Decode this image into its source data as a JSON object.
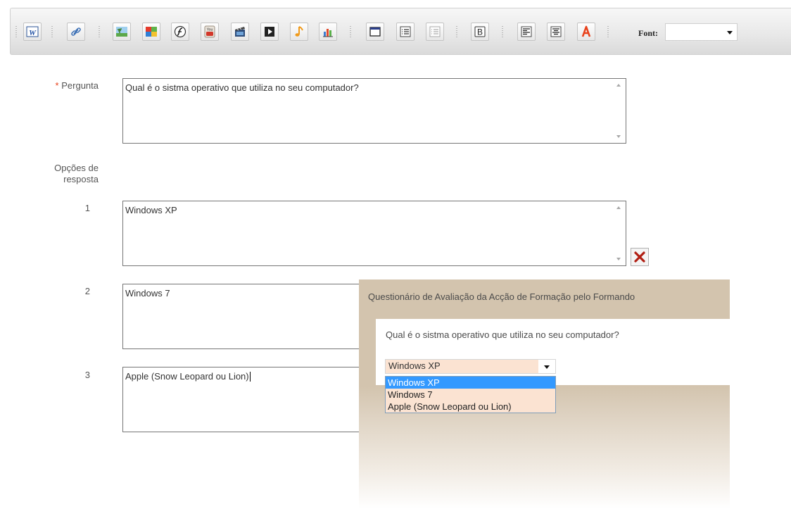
{
  "toolbar": {
    "buttons": [
      {
        "name": "word-icon"
      },
      {
        "name": "link-icon"
      },
      {
        "name": "image-icon"
      },
      {
        "name": "gallery-icon"
      },
      {
        "name": "flash-icon"
      },
      {
        "name": "youtube-icon"
      },
      {
        "name": "video-icon"
      },
      {
        "name": "play-icon"
      },
      {
        "name": "audio-icon"
      },
      {
        "name": "chart-icon"
      },
      {
        "name": "window-icon"
      },
      {
        "name": "list-icon"
      },
      {
        "name": "list-alt-icon"
      },
      {
        "name": "bold-icon"
      },
      {
        "name": "align-left-icon"
      },
      {
        "name": "align-center-icon"
      },
      {
        "name": "font-color-icon"
      }
    ],
    "font_label": "Font:",
    "font_value": ""
  },
  "form": {
    "required_mark": "*",
    "question_label": "Pergunta",
    "question_text": "Qual é o sistma operativo que utiliza no seu computador?",
    "options_label_line1": "Opções de",
    "options_label_line2": "resposta",
    "options": [
      {
        "number": "1",
        "text": "Windows XP"
      },
      {
        "number": "2",
        "text": "Windows 7"
      },
      {
        "number": "3",
        "text": "Apple (Snow Leopard ou Lion)"
      }
    ]
  },
  "preview": {
    "title": "Questionário de Avaliação da Acção de Formação pelo Formando",
    "question": "Qual é o sistma operativo que utiliza no seu computador?",
    "selected": "Windows XP",
    "options": [
      "Windows XP",
      "Windows 7",
      "Apple (Snow Leopard ou Lion)"
    ],
    "highlighted_index": 0
  },
  "colors": {
    "accent_red": "#e8421c",
    "selection_blue": "#3399ff",
    "preview_bg": "#d3c4ae",
    "select_bg": "#fbe3d2"
  }
}
